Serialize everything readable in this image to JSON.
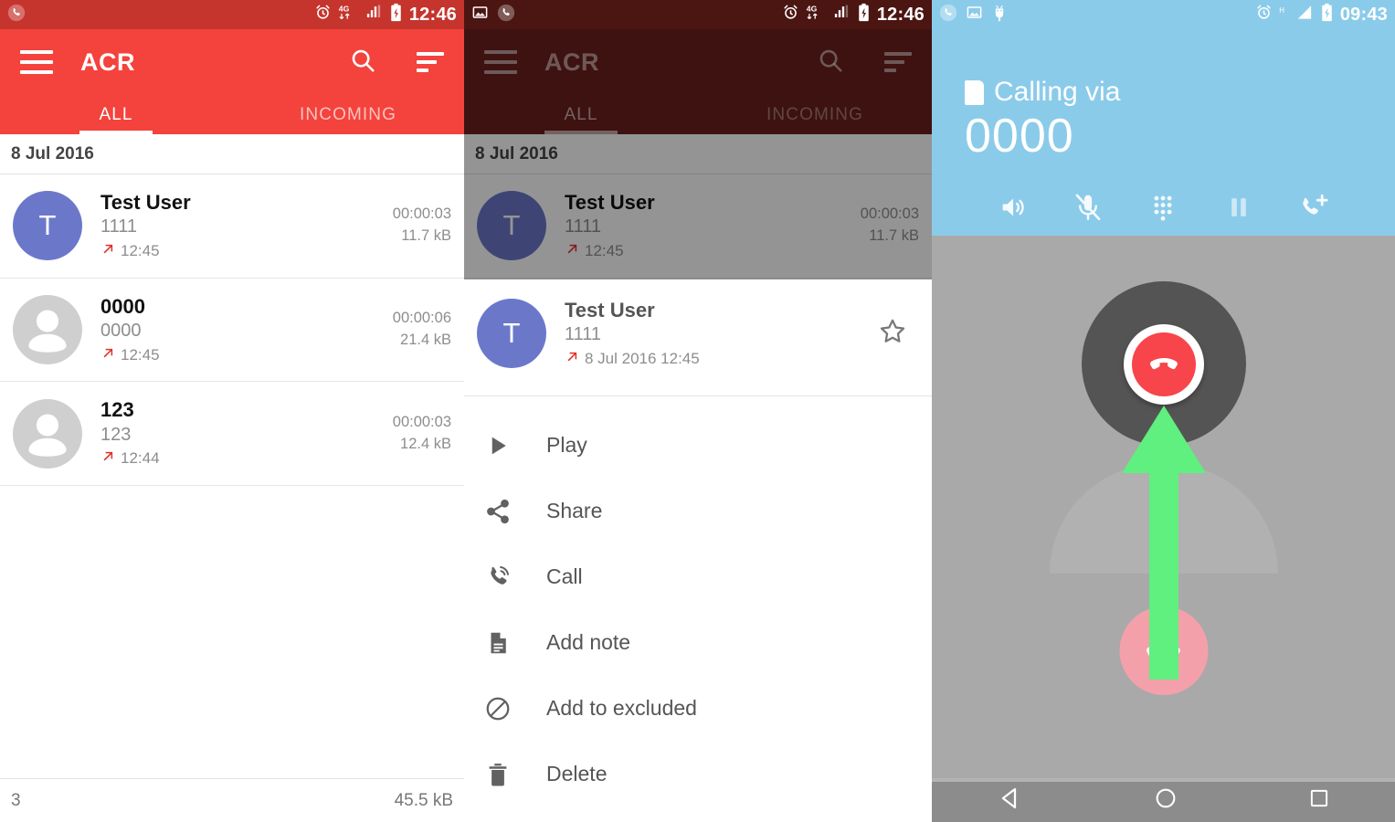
{
  "panel1": {
    "status_bar": {
      "icons": [
        "phone-icon",
        "alarm-icon",
        "4g-icon",
        "signal-icon",
        "battery-charging-icon"
      ],
      "time": "12:46"
    },
    "toolbar": {
      "title": "ACR",
      "menu_icon": "hamburger-icon",
      "search_icon": "search-icon",
      "sort_icon": "sort-icon"
    },
    "tabs": [
      {
        "label": "ALL",
        "selected": true
      },
      {
        "label": "INCOMING",
        "selected": false
      }
    ],
    "date_header": "8 Jul 2016",
    "rows": [
      {
        "avatar_letter": "T",
        "avatar_type": "letter",
        "name": "Test User",
        "number": "1111",
        "time": "12:45",
        "direction": "outgoing",
        "duration": "00:00:03",
        "size": "11.7 kB"
      },
      {
        "avatar_letter": "",
        "avatar_type": "generic",
        "name": "0000",
        "number": "0000",
        "time": "12:45",
        "direction": "outgoing",
        "duration": "00:00:06",
        "size": "21.4 kB"
      },
      {
        "avatar_letter": "",
        "avatar_type": "generic",
        "name": "123",
        "number": "123",
        "time": "12:44",
        "direction": "outgoing",
        "duration": "00:00:03",
        "size": "12.4 kB"
      }
    ],
    "bottom_bar": {
      "count": "3",
      "total_size": "45.5 kB"
    }
  },
  "panel2": {
    "status_bar": {
      "icons": [
        "image-icon",
        "phone-icon",
        "alarm-icon",
        "4g-icon",
        "signal-icon",
        "battery-charging-icon"
      ],
      "time": "12:46"
    },
    "toolbar": {
      "title": "ACR",
      "menu_icon": "hamburger-icon",
      "search_icon": "search-icon",
      "sort_icon": "sort-icon"
    },
    "tabs": [
      {
        "label": "ALL",
        "selected": true
      },
      {
        "label": "INCOMING",
        "selected": false
      }
    ],
    "date_header": "8 Jul 2016",
    "dimmed_row": {
      "avatar_letter": "T",
      "name": "Test User",
      "number": "1111",
      "time": "12:45",
      "duration": "00:00:03",
      "size": "11.7 kB"
    },
    "sheet_header": {
      "avatar_letter": "T",
      "name": "Test User",
      "number": "1111",
      "timestamp": "8 Jul 2016 12:45",
      "star_icon": "star-outline-icon"
    },
    "menu_items": [
      {
        "label": "Play",
        "icon": "play-icon"
      },
      {
        "label": "Share",
        "icon": "share-icon"
      },
      {
        "label": "Call",
        "icon": "call-icon"
      },
      {
        "label": "Add note",
        "icon": "note-icon"
      },
      {
        "label": "Add to excluded",
        "icon": "block-icon"
      },
      {
        "label": "Delete",
        "icon": "trash-icon"
      }
    ]
  },
  "panel3": {
    "status_bar": {
      "icons": [
        "phone-icon",
        "image-icon",
        "android-usb-icon",
        "alarm-icon",
        "hspa-icon",
        "signal-icon",
        "battery-charging-icon"
      ],
      "time": "09:43"
    },
    "calling_label": "Calling via",
    "calling_number": "0000",
    "sim_icon": "sim-card-icon",
    "controls": [
      {
        "name": "speaker-icon",
        "label": "Speaker"
      },
      {
        "name": "mute-icon",
        "label": "Mute"
      },
      {
        "name": "dialpad-icon",
        "label": "Dialpad"
      },
      {
        "name": "hold-icon",
        "label": "Hold"
      },
      {
        "name": "add-call-icon",
        "label": "Add call"
      }
    ],
    "record_button": {
      "icon": "record-call-icon"
    },
    "pink_button": {
      "icon": "end-call-icon"
    },
    "arrow": {
      "icon": "up-arrow-annotation",
      "color": "#5ff07f"
    },
    "nav_bar": [
      {
        "name": "back-button",
        "icon": "triangle-left-icon"
      },
      {
        "name": "home-button",
        "icon": "circle-icon"
      },
      {
        "name": "recents-button",
        "icon": "square-icon"
      }
    ]
  },
  "colors": {
    "primary_red": "#f4433c",
    "status_red": "#c5342d",
    "dim_red": "#6b201c",
    "dim_status_red": "#4b1512",
    "avatar_purple": "#6b78ca",
    "call_blue": "#8bcbea",
    "body_gray": "#a9a9a9",
    "nav_gray": "#8c8c8c",
    "arrow_green": "#5ff07f",
    "pink": "#f4a0aa",
    "hangup_red": "#f8444b",
    "outgoing_arrow_red": "#e03127"
  }
}
